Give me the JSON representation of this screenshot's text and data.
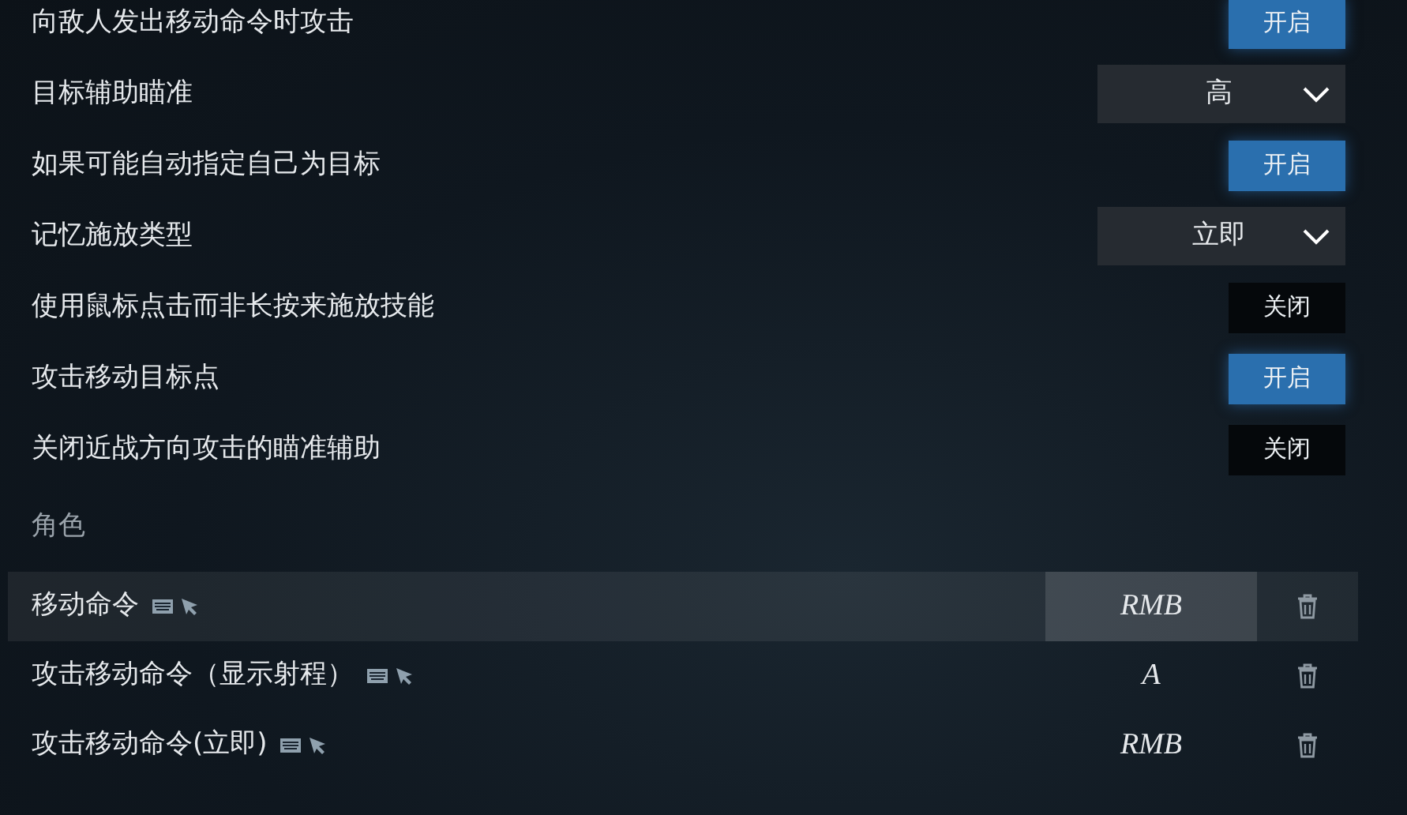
{
  "settings": [
    {
      "kind": "toggle",
      "label": "向敌人发出移动命令时攻击",
      "value": "开启",
      "on": true
    },
    {
      "kind": "dropdown",
      "label": "目标辅助瞄准",
      "value": "高"
    },
    {
      "kind": "toggle",
      "label": "如果可能自动指定自己为目标",
      "value": "开启",
      "on": true
    },
    {
      "kind": "dropdown",
      "label": "记忆施放类型",
      "value": "立即"
    },
    {
      "kind": "toggle",
      "label": "使用鼠标点击而非长按来施放技能",
      "value": "关闭",
      "on": false
    },
    {
      "kind": "toggle",
      "label": "攻击移动目标点",
      "value": "开启",
      "on": true
    },
    {
      "kind": "toggle",
      "label": "关闭近战方向攻击的瞄准辅助",
      "value": "关闭",
      "on": false
    }
  ],
  "section": "角色",
  "keybinds": [
    {
      "label": "移动命令",
      "key": "RMB",
      "selected": true
    },
    {
      "label": "攻击移动命令（显示射程）",
      "key": "A",
      "selected": false
    },
    {
      "label": "攻击移动命令(立即)",
      "key": "RMB",
      "selected": false
    }
  ]
}
